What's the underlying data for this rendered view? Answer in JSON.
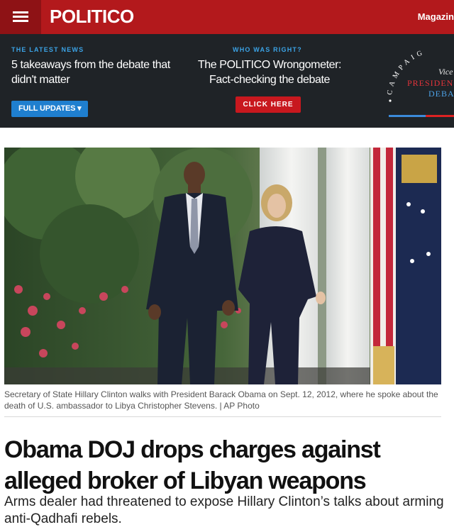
{
  "header": {
    "logo": "POLITICO",
    "nav_right": "Magazin"
  },
  "promo": {
    "left": {
      "eyebrow": "THE LATEST NEWS",
      "headline": "5 takeaways from the debate that didn't matter",
      "button": "FULL UPDATES ▾"
    },
    "center": {
      "eyebrow": "WHO WAS RIGHT?",
      "headline": "The POLITICO Wrongometer: Fact-checking the debate",
      "button": "CLICK HERE"
    },
    "badge": {
      "arc_text": "CAMPAIG",
      "line1": "Vice",
      "line2": "PRESIDEN",
      "line3": "DEBA"
    }
  },
  "article": {
    "caption": "Secretary of State Hillary Clinton walks with President Barack Obama on Sept. 12, 2012, where he spoke about the death of U.S. ambassador to Libya Christopher Stevens. | AP Photo",
    "headline": "Obama DOJ drops charges against alleged broker of Libyan weapons",
    "subhead": "Arms dealer had threatened to expose Hillary Clinton’s talks about arming anti-Qadhafi rebels."
  },
  "colors": {
    "brand_red": "#b3191c",
    "dark_bar": "#1f2327",
    "link_blue": "#3ba3e6",
    "button_blue": "#1f7fcf",
    "button_red": "#c8181e"
  }
}
